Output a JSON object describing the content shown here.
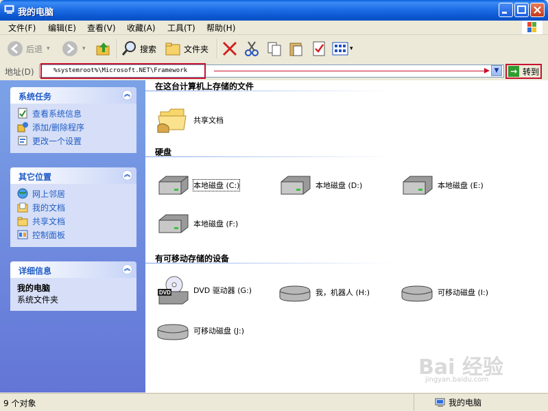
{
  "window": {
    "title": "我的电脑"
  },
  "menu": [
    "文件(F)",
    "编辑(E)",
    "查看(V)",
    "收藏(A)",
    "工具(T)",
    "帮助(H)"
  ],
  "toolbar": {
    "back": "后退",
    "search": "搜索",
    "folders": "文件夹"
  },
  "address": {
    "label": "地址(D)",
    "value": "%systemroot%\\Microsoft.NET\\Framework",
    "go": "转到"
  },
  "sidebar": {
    "tasks": {
      "title": "系统任务",
      "items": [
        "查看系统信息",
        "添加/删除程序",
        "更改一个设置"
      ]
    },
    "places": {
      "title": "其它位置",
      "items": [
        "网上邻居",
        "我的文档",
        "共享文档",
        "控制面板"
      ]
    },
    "details": {
      "title": "详细信息",
      "name": "我的电脑",
      "type": "系统文件夹"
    }
  },
  "content": {
    "groups": [
      "在这台计算机上存储的文件",
      "硬盘",
      "有可移动存储的设备"
    ],
    "shared": "共享文档",
    "disks": [
      "本地磁盘 (C:)",
      "本地磁盘 (D:)",
      "本地磁盘 (E:)",
      "本地磁盘 (F:)"
    ],
    "removable": [
      "DVD 驱动器 (G:)",
      "我，机器人 (H:)",
      "可移动磁盘 (I:)",
      "可移动磁盘 (J:)"
    ],
    "dvd_badge": "DVD"
  },
  "status": {
    "left": "9 个对象",
    "right": "我的电脑"
  },
  "watermark": {
    "line1": "Bai 经验",
    "line2": "jingyan.baidu.com"
  }
}
